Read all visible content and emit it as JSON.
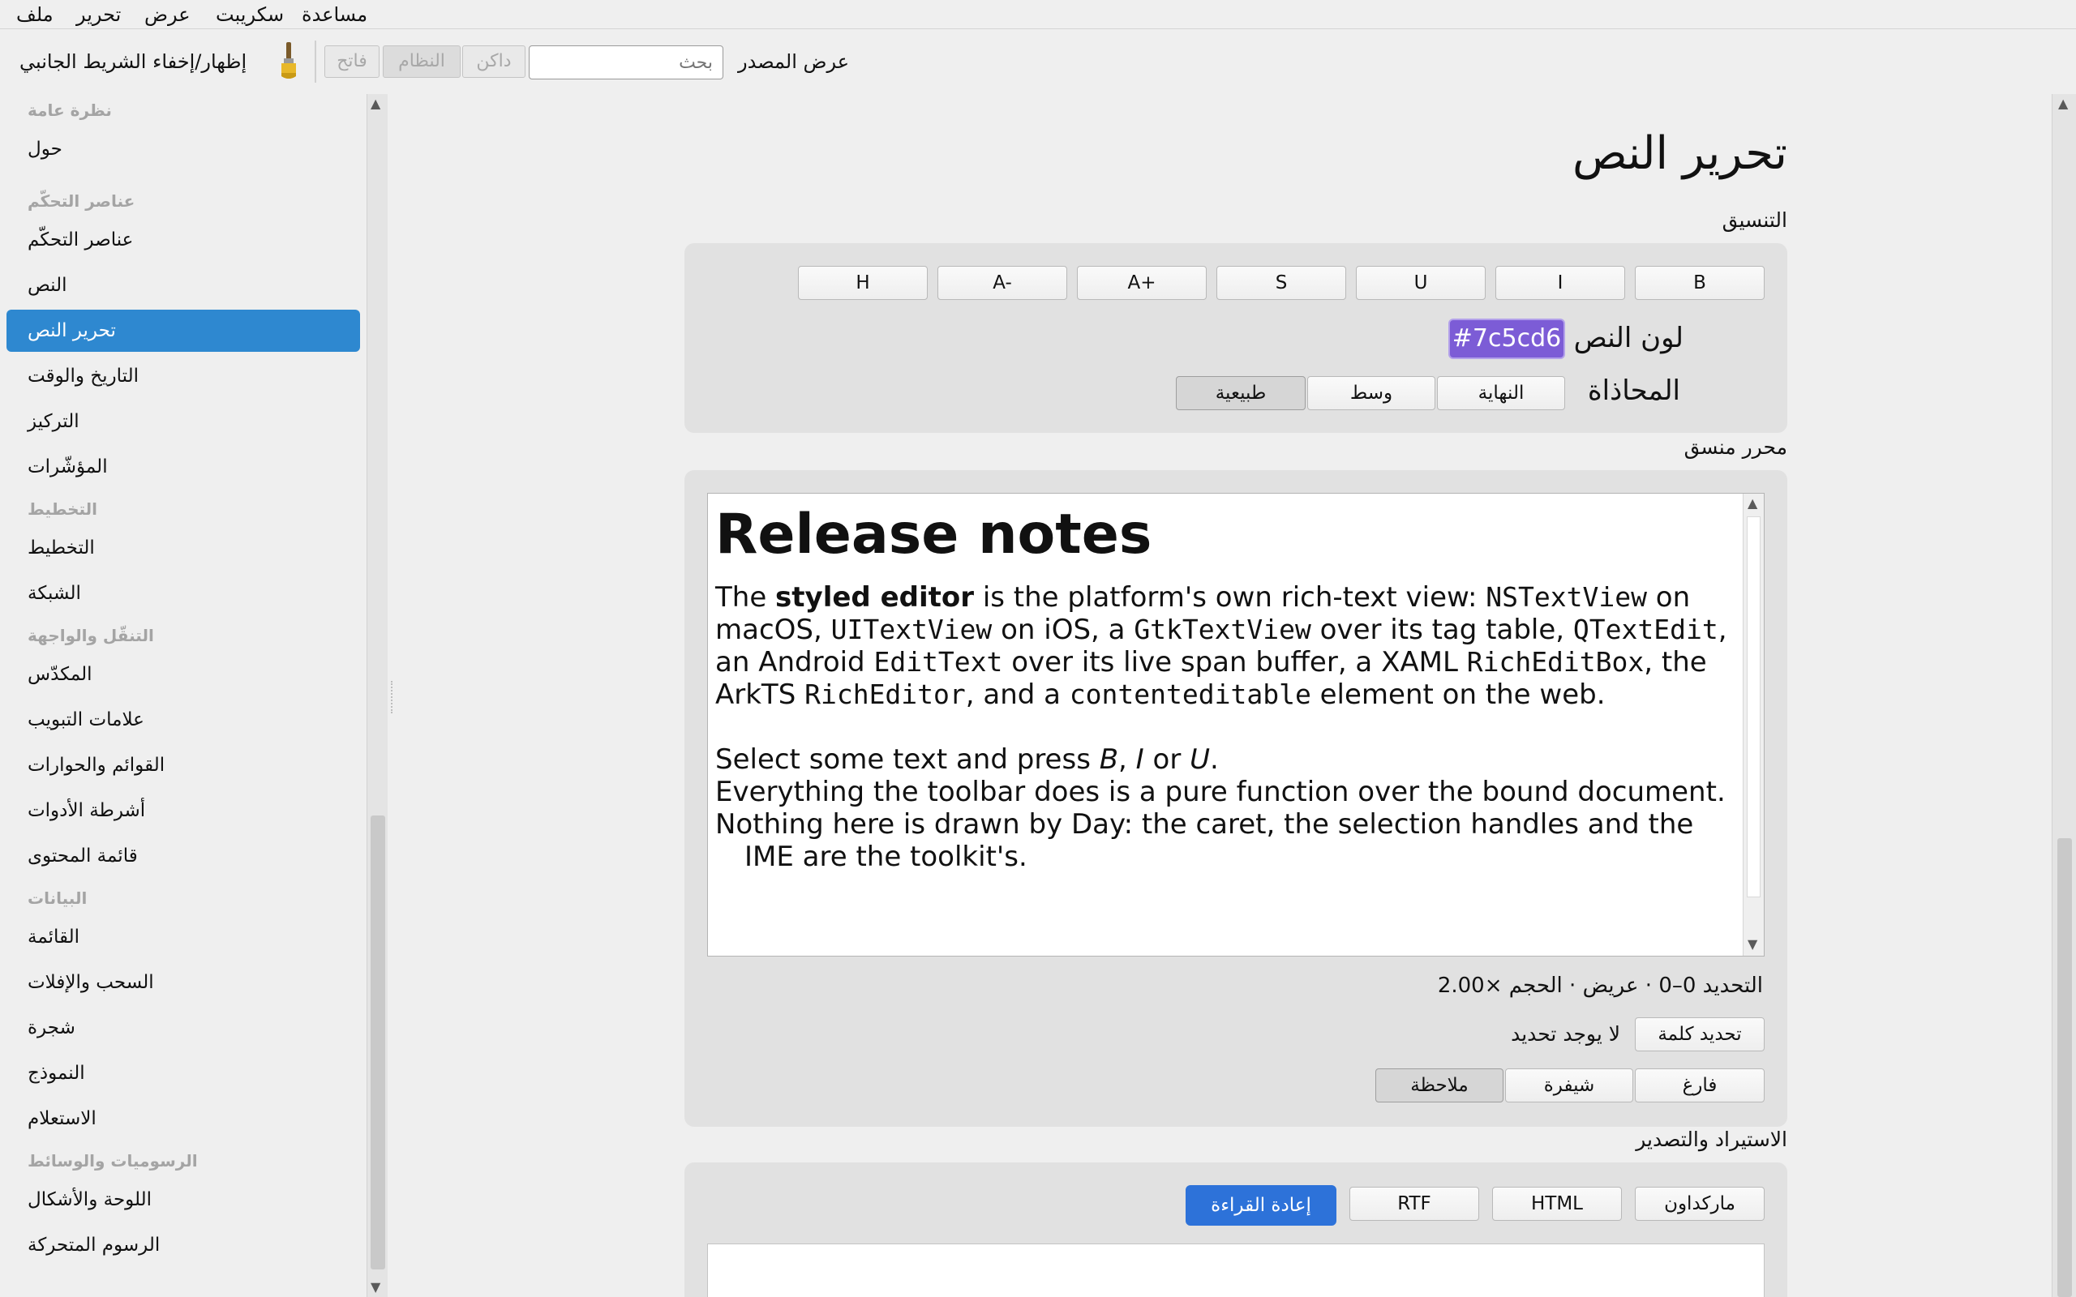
{
  "menu": {
    "file": "ملف",
    "edit": "تحرير",
    "view": "عرض",
    "script": "سكريبت",
    "help": "مساعدة"
  },
  "toolbar": {
    "toggle_sidebar": "إظهار/إخفاء الشريط الجانبي",
    "theme_light": "فاتح",
    "theme_system": "النظام",
    "theme_dark": "داكن",
    "search_placeholder": "بحث",
    "view_source": "عرض المصدر"
  },
  "sidebar": {
    "items": [
      {
        "type": "header",
        "label": "نظرة عامة"
      },
      {
        "type": "item",
        "label": "حول"
      },
      {
        "type": "header",
        "label": "عناصر التحكّم"
      },
      {
        "type": "item",
        "label": "عناصر التحكّم"
      },
      {
        "type": "item",
        "label": "النص"
      },
      {
        "type": "item",
        "label": "تحرير النص",
        "active": true
      },
      {
        "type": "item",
        "label": "التاريخ والوقت"
      },
      {
        "type": "item",
        "label": "التركيز"
      },
      {
        "type": "item",
        "label": "المؤشّرات"
      },
      {
        "type": "header",
        "label": "التخطيط"
      },
      {
        "type": "item",
        "label": "التخطيط"
      },
      {
        "type": "item",
        "label": "الشبكة"
      },
      {
        "type": "header",
        "label": "التنقّل والواجهة"
      },
      {
        "type": "item",
        "label": "المكدّس"
      },
      {
        "type": "item",
        "label": "علامات التبويب"
      },
      {
        "type": "item",
        "label": "القوائم والحوارات"
      },
      {
        "type": "item",
        "label": "أشرطة الأدوات"
      },
      {
        "type": "item",
        "label": "قائمة المحتوى"
      },
      {
        "type": "header",
        "label": "البيانات"
      },
      {
        "type": "item",
        "label": "القائمة"
      },
      {
        "type": "item",
        "label": "السحب والإفلات"
      },
      {
        "type": "item",
        "label": "شجرة"
      },
      {
        "type": "item",
        "label": "النموذج"
      },
      {
        "type": "item",
        "label": "الاستعلام"
      },
      {
        "type": "header",
        "label": "الرسوميات والوسائط"
      },
      {
        "type": "item",
        "label": "اللوحة والأشكال"
      },
      {
        "type": "item",
        "label": "الرسوم المتحركة"
      }
    ]
  },
  "page": {
    "title": "تحرير النص",
    "formatting_label": "التنسيق",
    "format_buttons": [
      "B",
      "I",
      "U",
      "S",
      "A+",
      "A-",
      "H"
    ],
    "text_color_label": "لون النص",
    "text_color_value": "#7c5cd6",
    "alignment_label": "المحاذاة",
    "alignment_options": [
      "النهاية",
      "وسط",
      "طبيعية"
    ],
    "alignment_selected": "طبيعية",
    "rich_editor_label": "محرر منسق",
    "editor": {
      "heading": "Release notes",
      "p1": [
        {
          "t": "The "
        },
        {
          "t": "styled editor",
          "b": true
        },
        {
          "t": " is the platform's own rich-text view: "
        },
        {
          "t": "NSTextView",
          "m": true
        },
        {
          "t": " on macOS, "
        },
        {
          "t": "UITextView",
          "m": true
        },
        {
          "t": " on iOS, a "
        },
        {
          "t": "GtkTextView",
          "m": true
        },
        {
          "t": " over its tag table, "
        },
        {
          "t": "QTextEdit",
          "m": true
        },
        {
          "t": ", an Android "
        },
        {
          "t": "EditText",
          "m": true
        },
        {
          "t": " over its live span buffer, a XAML "
        },
        {
          "t": "RichEditBox",
          "m": true
        },
        {
          "t": ", the ArkTS "
        },
        {
          "t": "RichEditor",
          "m": true
        },
        {
          "t": ", and a "
        },
        {
          "t": "contenteditable",
          "m": true
        },
        {
          "t": " element on the web."
        }
      ],
      "p2": [
        {
          "t": "Select some text and press "
        },
        {
          "t": "B",
          "i": true
        },
        {
          "t": ", "
        },
        {
          "t": "I",
          "i": true
        },
        {
          "t": " or "
        },
        {
          "t": "U",
          "i": true
        },
        {
          "t": "."
        }
      ],
      "p3": "Everything the toolbar does is a pure function over the bound document.",
      "p4": "Nothing here is drawn by Day: the caret, the selection handles and the IME are the toolkit's."
    },
    "selection_status": "التحديد 0–0 · عريض · الحجم ×2.00",
    "select_word_button": "تحديد كلمة",
    "no_selection_text": "لا يوجد تحديد",
    "load_buttons": [
      "فارغ",
      "شيفرة",
      "ملاحظة"
    ],
    "load_selected": "ملاحظة",
    "import_export_label": "الاستيراد والتصدير",
    "export_buttons": [
      "ماركداون",
      "HTML",
      "RTF"
    ],
    "reread_button": "إعادة القراءة"
  },
  "colors": {
    "accent": "#2e88d0",
    "primary_button": "#2d72d9",
    "text_color_swatch": "#7c5cd6"
  },
  "icons": {
    "theme_toggle": "paintbrush-icon"
  }
}
